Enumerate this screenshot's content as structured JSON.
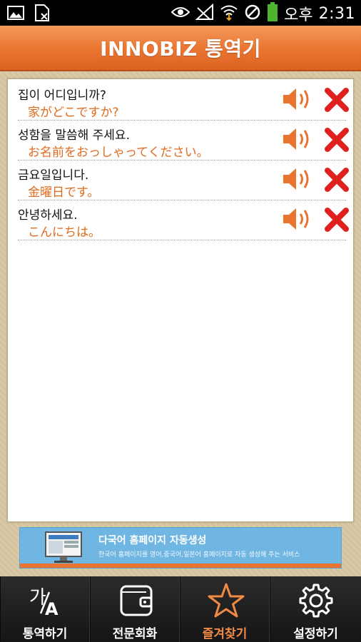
{
  "status_bar": {
    "ampm": "오후",
    "time": "2:31",
    "icons": [
      "picture-icon",
      "document-icon",
      "eye-icon",
      "signal-muted-icon",
      "wifi-icon",
      "blocked-icon",
      "battery-icon"
    ]
  },
  "header": {
    "title": "INNOBIZ 통역기"
  },
  "favorites": [
    {
      "korean": "집이 어디입니까?",
      "japanese": "家がどこですか?"
    },
    {
      "korean": "성함을 말씀해 주세요.",
      "japanese": "お名前をおっしゃってください。"
    },
    {
      "korean": "금요일입니다.",
      "japanese": "金曜日です。"
    },
    {
      "korean": "안녕하세요.",
      "japanese": "こんにちは。"
    }
  ],
  "banner": {
    "title": "다국어 홈페이지 자동생성",
    "subtitle": "한국어 홈페이지를 영어,중국어,일본어 홈페이지로 자동 생성해 주는 서비스"
  },
  "tabs": [
    {
      "label": "통역하기",
      "icon": "translate-icon"
    },
    {
      "label": "전문회화",
      "icon": "wallet-icon"
    },
    {
      "label": "즐겨찾기",
      "icon": "star-icon",
      "active": true
    },
    {
      "label": "설정하기",
      "icon": "gear-icon"
    }
  ],
  "colors": {
    "accent": "#e9732f",
    "japanese_text": "#e06b1d",
    "delete": "#e0201c",
    "banner": "#70b6e3"
  }
}
